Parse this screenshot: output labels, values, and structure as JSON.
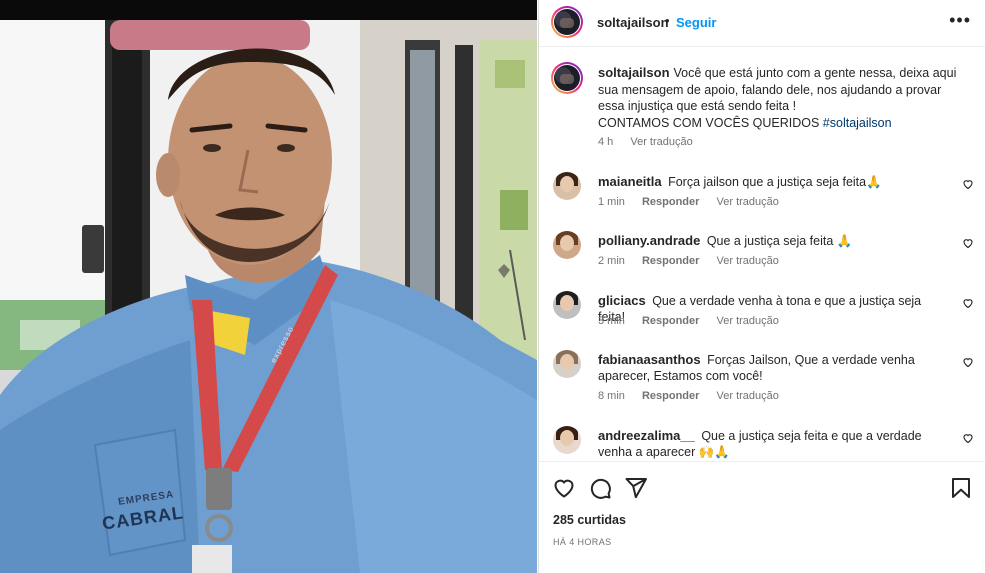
{
  "post": {
    "username": "soltajailson",
    "follow_label": "Seguir",
    "more_label": "•••",
    "caption_lines": [
      "Você que está junto com a gente nessa, deixa aqui sua mensagem de apoio, falando dele, nos ajudando a provar essa injustiça que está sendo feita !",
      "CONTAMOS COM VOCÊS QUERIDOS "
    ],
    "hashtag": "#soltajailson",
    "caption_time": "4 h",
    "caption_translate": "Ver tradução"
  },
  "comments": [
    {
      "username": "maianeitla",
      "text": "Força jailson que a justiça seja feita🙏",
      "time": "1 min",
      "reply": "Responder",
      "translate": "Ver tradução"
    },
    {
      "username": "polliany.andrade",
      "text": "Que a justiça seja feita 🙏",
      "time": "2 min",
      "reply": "Responder",
      "translate": "Ver tradução"
    },
    {
      "username": "gliciacs",
      "text": "Que a verdade venha à tona e que a justiça seja feita!",
      "time": "3 min",
      "reply": "Responder",
      "translate": "Ver tradução"
    },
    {
      "username": "fabianaasanthos",
      "text": "Forças Jailson, Que a verdade venha aparecer, Estamos com você!",
      "time": "8 min",
      "reply": "Responder",
      "translate": "Ver tradução"
    },
    {
      "username": "andreezalima__",
      "text": "Que a justiça seja feita e que a verdade venha a aparecer 🙌🙏",
      "time": "",
      "reply": "",
      "translate": ""
    }
  ],
  "footer": {
    "likes": "285 curtidas",
    "posted": "HÁ 4 HORAS"
  },
  "photo": {
    "badge_line1": "EMPRESA",
    "badge_line2": "CABRAL",
    "lanyard_text": "expresso"
  },
  "icons": [
    "heart-icon",
    "comment-icon",
    "share-icon",
    "bookmark-icon",
    "more-options-icon"
  ],
  "colors": {
    "link": "#0095f6",
    "hashtag": "#00376b",
    "muted": "#737373",
    "shirt": "#6b9ccd",
    "lanyard": "#d44a4a"
  }
}
